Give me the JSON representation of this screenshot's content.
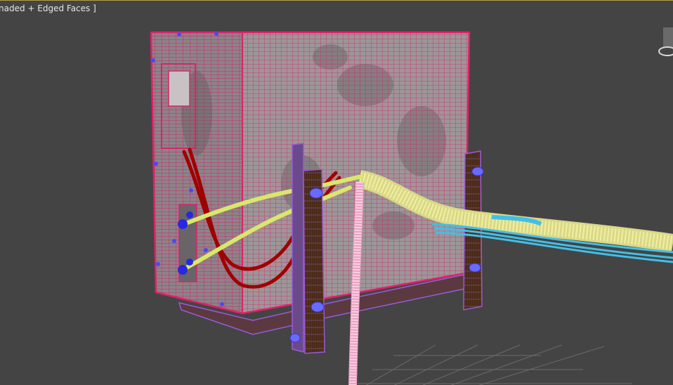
{
  "viewport": {
    "shading_label": "naded + Edged Faces ]",
    "selected_wire_color": "#e0206a",
    "background_color": "#444444",
    "grid_color": "#6a6a6a"
  },
  "scene_objects": [
    {
      "name": "ac-unit-body",
      "kind": "box-mesh",
      "color": "#e0206a"
    },
    {
      "name": "wooden-post-front",
      "kind": "cylinder-mesh",
      "color": "#9a5ad8"
    },
    {
      "name": "wooden-post-right",
      "kind": "cylinder-mesh",
      "color": "#9a5ad8"
    },
    {
      "name": "red-pipe-loop",
      "kind": "spline",
      "color": "#a00000"
    },
    {
      "name": "yellow-cable-upper",
      "kind": "spline",
      "color": "#d8e86a"
    },
    {
      "name": "yellow-cable-lower",
      "kind": "spline",
      "color": "#d8e86a"
    },
    {
      "name": "corrugated-hose",
      "kind": "spline-mesh",
      "color": "#f0f0a0"
    },
    {
      "name": "cyan-cable-bundle",
      "kind": "spline",
      "color": "#40c0e8"
    },
    {
      "name": "pink-drain-hose",
      "kind": "spline-mesh",
      "color": "#f0a8c8"
    }
  ],
  "viewcube": {
    "icon": "viewcube-icon"
  }
}
